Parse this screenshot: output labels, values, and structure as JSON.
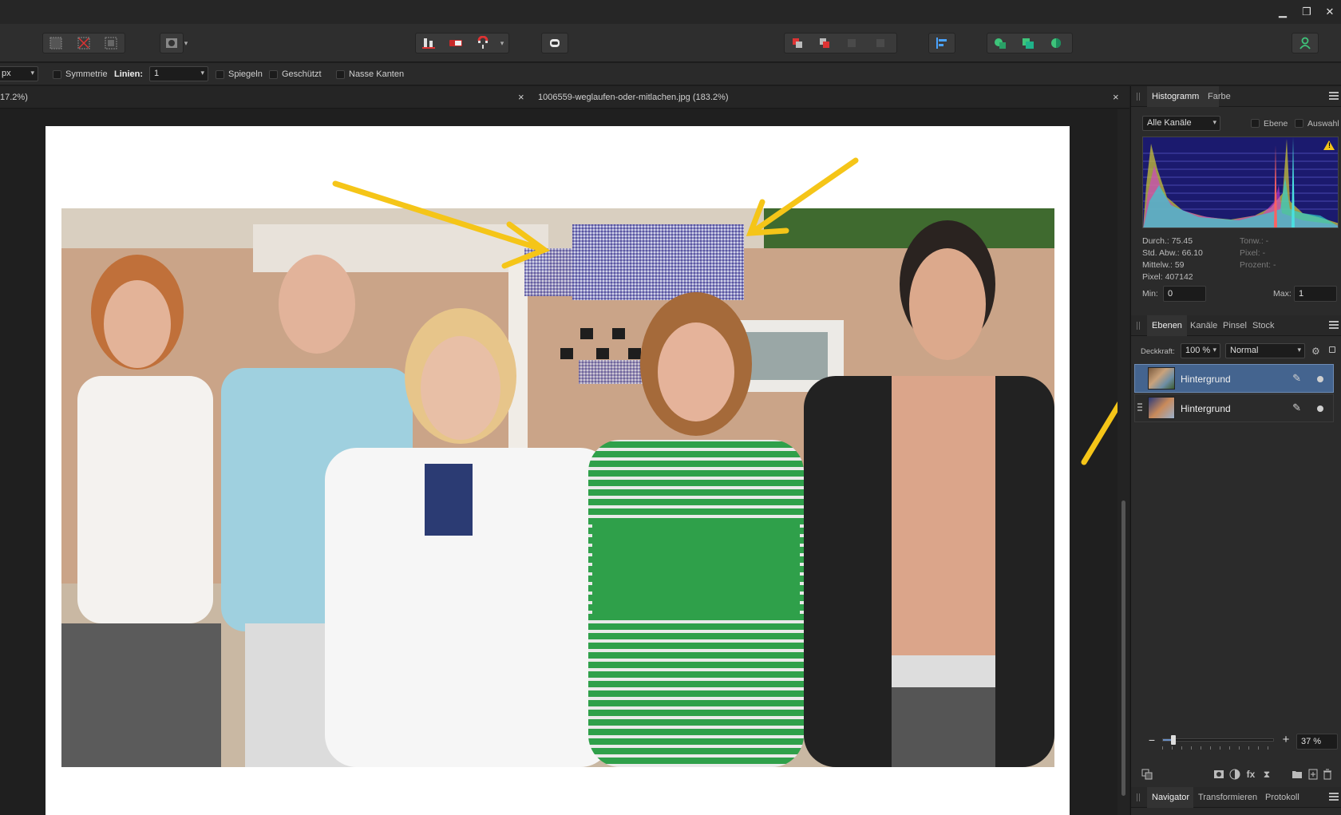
{
  "window": {
    "minimize": "▁",
    "restore": "❐",
    "close": "✕"
  },
  "context_toolbar": {
    "unit_value": "px",
    "symmetry_label": "Symmetrie",
    "lines_label": "Linien:",
    "lines_value": "1",
    "mirror_label": "Spiegeln",
    "protected_label": "Geschützt",
    "wet_edges_label": "Nasse Kanten"
  },
  "document": {
    "left_tab_partial": "17.2%)",
    "tab_title": "1006559-weglaufen-oder-mitlachen.jpg (183.2%)",
    "close_symbol": "×"
  },
  "histogram_panel": {
    "tabs": [
      "Histogramm",
      "Farbe"
    ],
    "channel_select": "Alle Kanäle",
    "layer_check_label": "Ebene",
    "selection_check_label": "Auswahl",
    "warning": "!",
    "stats": {
      "mean": "Durch.: 75.45",
      "stddev": "Std. Abw.: 66.10",
      "median": "Mittelw.: 59",
      "pixels": "Pixel: 407142",
      "tone": "Tonw.: -",
      "pixel_hover": "Pixel: -",
      "percent": "Prozent: -"
    },
    "min_label": "Min:",
    "min_value": "0",
    "max_label": "Max:",
    "max_value": "1"
  },
  "layers_panel": {
    "tabs": [
      "Ebenen",
      "Kanäle",
      "Pinsel",
      "Stock"
    ],
    "opacity_label": "Deckkraft:",
    "opacity_value": "100 %",
    "blend_mode": "Normal",
    "layers": [
      {
        "name": "Hintergrund",
        "selected": true
      },
      {
        "name": "Hintergrund",
        "selected": false
      }
    ]
  },
  "navigator_panel": {
    "tabs": [
      "Navigator",
      "Transformieren",
      "Protokoll"
    ],
    "zoom_minus": "−",
    "zoom_plus": "+",
    "zoom_value": "37 %",
    "zoom_fraction": 0.09
  },
  "colors": {
    "accent_blue": "#44648f",
    "annotation_yellow": "#f5c518",
    "user_icon": "#3ec47a"
  }
}
